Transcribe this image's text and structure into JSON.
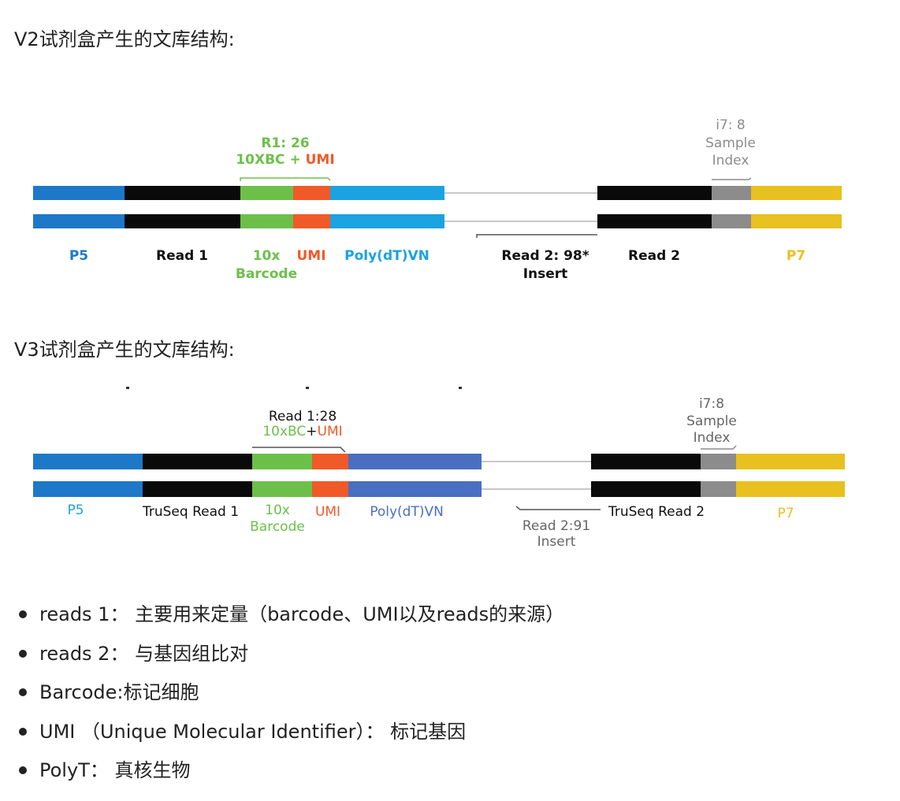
{
  "v2": {
    "heading": "V2试剂盒产生的文库结构:",
    "read1_header": "R1: 26",
    "read1_sub_a": "10XBC",
    "read1_sub_plus": " + ",
    "read1_sub_b": "UMI",
    "i7_l1": "i7: 8",
    "i7_l2": "Sample",
    "i7_l3": "Index",
    "labels": {
      "p5": "P5",
      "read1": "Read 1",
      "barcode_l1": "10x",
      "barcode_l2": "Barcode",
      "umi": "UMI",
      "polydt": "Poly(dT)VN",
      "insert_l1": "Read 2: 98*",
      "insert_l2": "Insert",
      "read2": "Read 2",
      "p7": "P7"
    }
  },
  "v3": {
    "heading": "V3试剂盒产生的文库结构:",
    "read1_header": "Read 1:28",
    "read1_sub_a": "10xBC",
    "read1_sub_plus": "+",
    "read1_sub_b": "UMI",
    "i7_l1": "i7:8",
    "i7_l2": "Sample",
    "i7_l3": "Index",
    "labels": {
      "p5": "P5",
      "read1": "TruSeq Read 1",
      "barcode_l1": "10x",
      "barcode_l2": "Barcode",
      "umi": "UMI",
      "polydt": "Poly(dT)VN",
      "insert_l1": "Read 2:91",
      "insert_l2": "Insert",
      "read2": "TruSeq Read 2",
      "p7": "P7"
    }
  },
  "segment_colors": {
    "p5": "#1e78c8",
    "read": "#0a0a0a",
    "barcode": "#6cc04a",
    "umi": "#f05a28",
    "polydt_v2": "#1aa3e0",
    "polydt_v3": "#4a6fc0",
    "sample_index": "#8c8c8c",
    "p7": "#e8c020",
    "insert_line": "#c8c8c8"
  },
  "bullets": [
    "reads 1： 主要用来定量（barcode、UMI以及reads的来源）",
    "reads 2： 与基因组比对",
    "Barcode:标记细胞",
    "UMI （Unique Molecular Identifier）： 标记基因",
    "PolyT： 真核生物"
  ]
}
